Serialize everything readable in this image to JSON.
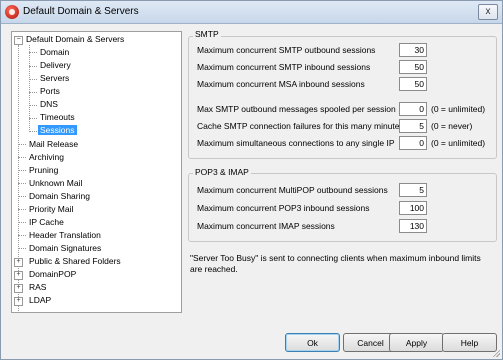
{
  "window": {
    "title": "Default Domain & Servers",
    "close_glyph": "x"
  },
  "tree": {
    "root": "Default Domain & Servers",
    "children": [
      "Domain",
      "Delivery",
      "Servers",
      "Ports",
      "DNS",
      "Timeouts",
      "Sessions"
    ],
    "selected": "Sessions",
    "items": [
      "Mail Release",
      "Archiving",
      "Pruning",
      "Unknown Mail",
      "Domain Sharing",
      "Priority Mail",
      "IP Cache",
      "Header Translation",
      "Domain Signatures"
    ],
    "expandable": [
      "Public & Shared Folders",
      "DomainPOP",
      "RAS",
      "LDAP"
    ]
  },
  "smtp": {
    "heading": "SMTP",
    "rows": [
      {
        "label": "Maximum concurrent SMTP outbound sessions",
        "value": "30",
        "hint": ""
      },
      {
        "label": "Maximum concurrent SMTP inbound sessions",
        "value": "50",
        "hint": ""
      },
      {
        "label": "Maximum concurrent MSA inbound sessions",
        "value": "50",
        "hint": ""
      },
      {
        "label": "Max SMTP outbound messages spooled per session",
        "value": "0",
        "hint": "(0 = unlimited)"
      },
      {
        "label": "Cache SMTP connection failures for this many minutes",
        "value": "5",
        "hint": "(0 = never)"
      },
      {
        "label": "Maximum simultaneous connections to any single IP",
        "value": "0",
        "hint": "(0 = unlimited)"
      }
    ]
  },
  "pop": {
    "heading": "POP3 & IMAP",
    "rows": [
      {
        "label": "Maximum concurrent MultiPOP outbound sessions",
        "value": "5"
      },
      {
        "label": "Maximum concurrent POP3 inbound sessions",
        "value": "100"
      },
      {
        "label": "Maximum concurrent IMAP sessions",
        "value": "130"
      }
    ]
  },
  "note": "\"Server Too Busy\" is sent to connecting clients when maximum inbound limits are reached.",
  "buttons": {
    "ok": "Ok",
    "cancel": "Cancel",
    "apply": "Apply",
    "help": "Help"
  }
}
